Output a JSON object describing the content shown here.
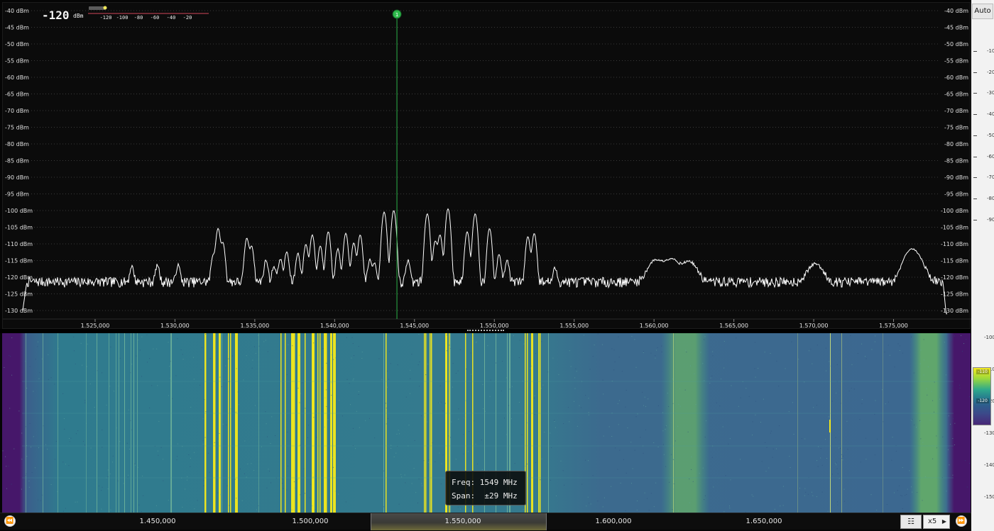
{
  "meter": {
    "value": "-120",
    "unit": "dBm",
    "scale_labels": [
      "-120",
      "-100",
      "-80",
      "-60",
      "-40",
      "-20"
    ]
  },
  "spectrum": {
    "db_labels_left": [
      "-40 dBm",
      "-45 dBm",
      "-50 dBm",
      "-55 dBm",
      "-60 dBm",
      "-65 dBm",
      "-70 dBm",
      "-75 dBm",
      "-80 dBm",
      "-85 dBm",
      "-90 dBm",
      "-95 dBm",
      "-100 dBm",
      "-105 dBm",
      "-110 dBm",
      "-115 dBm",
      "-120 dBm",
      "-125 dBm",
      "-130 dBm"
    ],
    "db_labels_right": [
      "-40 dBm",
      "-45 dBm",
      "-50 dBm",
      "-55 dBm",
      "-60 dBm",
      "-65 dBm",
      "-70 dBm",
      "-75 dBm",
      "-80 dBm",
      "-85 dBm",
      "-90 dBm",
      "-95 dBm",
      "-100 dBm",
      "-105 dBm",
      "-110 dBm",
      "-115 dBm",
      "-120 dBm",
      "-125 dBm",
      "-130 dBm"
    ],
    "freq_labels": [
      "1.525,000",
      "1.530,000",
      "1.535,000",
      "1.540,000",
      "1.545,000",
      "1.550,000",
      "1.555,000",
      "1.560,000",
      "1.565,000",
      "1.570,000",
      "1.575,000"
    ],
    "marker": {
      "label": "1",
      "color": "#2db84a"
    },
    "trace_color": "#ffffff"
  },
  "chart_data": {
    "type": "line",
    "title": "",
    "xlabel": "",
    "ylabel": "",
    "x_unit": "MHz",
    "y_unit": "dBm",
    "xlim": [
      1521.0,
      1578.0
    ],
    "ylim": [
      -132,
      -38
    ],
    "marker_x": 1543.9,
    "baseline_dbm": -121.5,
    "peaks": [
      {
        "x": 1527.3,
        "y": -118.5
      },
      {
        "x": 1528.9,
        "y": -118.0
      },
      {
        "x": 1530.2,
        "y": -118.0
      },
      {
        "x": 1532.4,
        "y": -114.0
      },
      {
        "x": 1532.7,
        "y": -105.5
      },
      {
        "x": 1533.0,
        "y": -110.0
      },
      {
        "x": 1534.5,
        "y": -108.5
      },
      {
        "x": 1534.8,
        "y": -111.0
      },
      {
        "x": 1535.7,
        "y": -116.0
      },
      {
        "x": 1536.2,
        "y": -118.5
      },
      {
        "x": 1536.6,
        "y": -115.5
      },
      {
        "x": 1537.0,
        "y": -113.0
      },
      {
        "x": 1537.7,
        "y": -113.5
      },
      {
        "x": 1538.2,
        "y": -110.5
      },
      {
        "x": 1538.6,
        "y": -107.5
      },
      {
        "x": 1539.1,
        "y": -111.0
      },
      {
        "x": 1539.6,
        "y": -106.5
      },
      {
        "x": 1540.2,
        "y": -112.0
      },
      {
        "x": 1540.7,
        "y": -107.0
      },
      {
        "x": 1541.2,
        "y": -110.0
      },
      {
        "x": 1541.6,
        "y": -107.5
      },
      {
        "x": 1542.2,
        "y": -116.0
      },
      {
        "x": 1542.5,
        "y": -117.0
      },
      {
        "x": 1543.1,
        "y": -100.5
      },
      {
        "x": 1543.7,
        "y": -100.0
      },
      {
        "x": 1544.6,
        "y": -116.0
      },
      {
        "x": 1545.8,
        "y": -101.0
      },
      {
        "x": 1546.3,
        "y": -109.5
      },
      {
        "x": 1546.6,
        "y": -107.5
      },
      {
        "x": 1547.1,
        "y": -99.5
      },
      {
        "x": 1548.3,
        "y": -106.5
      },
      {
        "x": 1548.8,
        "y": -101.0
      },
      {
        "x": 1549.7,
        "y": -105.5
      },
      {
        "x": 1550.3,
        "y": -114.0
      },
      {
        "x": 1550.8,
        "y": -116.0
      },
      {
        "x": 1552.1,
        "y": -108.0
      },
      {
        "x": 1552.5,
        "y": -107.0
      },
      {
        "x": 1553.8,
        "y": -119.5
      },
      {
        "x": 1560.1,
        "y": -116.0
      },
      {
        "x": 1561.1,
        "y": -115.5
      },
      {
        "x": 1562.2,
        "y": -116.5
      },
      {
        "x": 1570.1,
        "y": -117.5
      },
      {
        "x": 1576.1,
        "y": -112.5
      },
      {
        "x": 1576.6,
        "y": -118.5
      }
    ]
  },
  "waterfall": {
    "freq_labels": [
      "1.450,000",
      "1.500,000",
      "1.550,000",
      "1.600,000",
      "1.650,000"
    ],
    "scale_right": [
      "-100",
      "-110",
      "-120",
      "-130",
      "-140",
      "-150"
    ]
  },
  "tooltip": {
    "freq_line": "Freq: 1549 MHz",
    "span_line": "Span:  ±29 MHz"
  },
  "right_panel": {
    "auto_label": "Auto",
    "scale_top": [
      "-10",
      "-20",
      "-30",
      "-40",
      "-50",
      "-60",
      "-70",
      "-80",
      "-90"
    ],
    "colorbar_labels": [
      "-110",
      "-120"
    ]
  },
  "bottom_bar": {
    "zoom_label": "x5",
    "prev_icon": "⏪",
    "next_icon": "⏩",
    "layers_icon": "☷",
    "zoom_arrow": "▶"
  },
  "colors": {
    "signal_strong": "#f2e81c",
    "waterfall_base": "#3b6f8e",
    "waterfall_edge": "#46176a",
    "marker_line": "#2cb348"
  }
}
